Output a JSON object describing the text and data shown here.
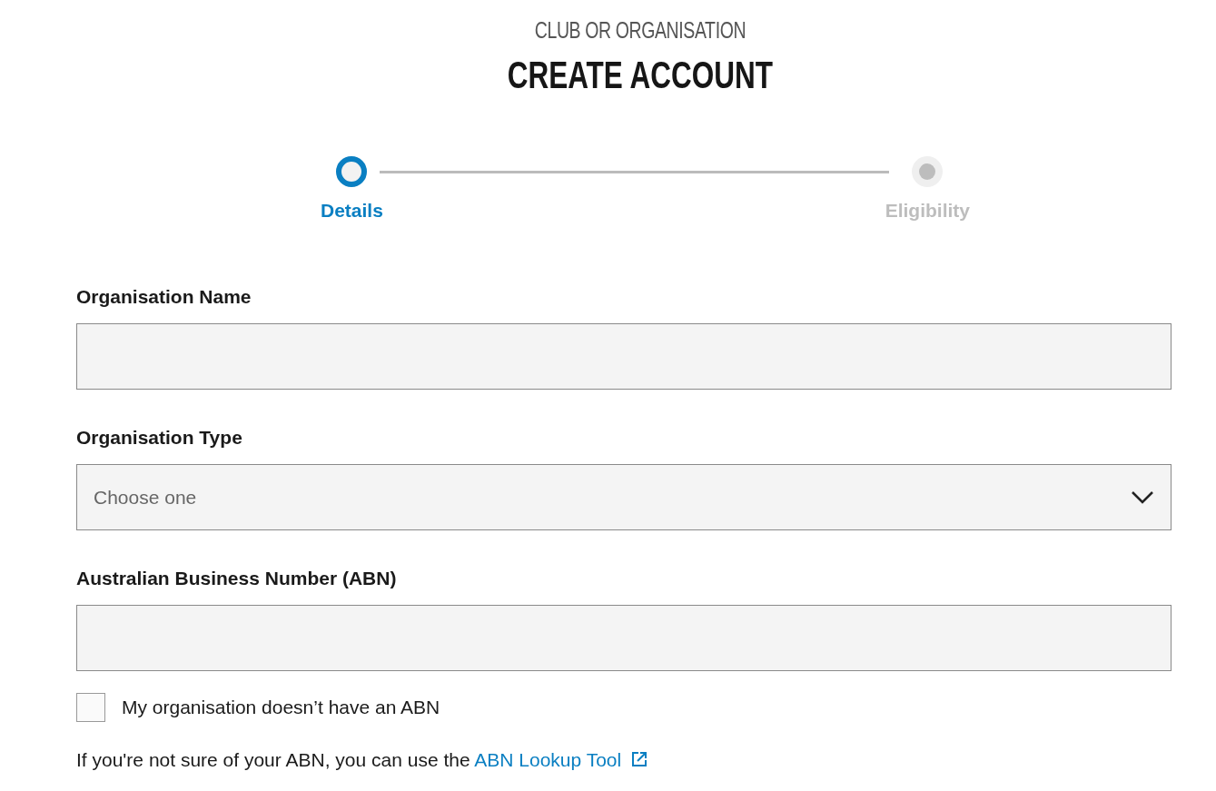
{
  "header": {
    "subtitle": "CLUB OR ORGANISATION",
    "title": "CREATE ACCOUNT"
  },
  "steps": [
    {
      "label": "Details",
      "selected": true
    },
    {
      "label": "Eligibility",
      "selected": false
    }
  ],
  "fields": [
    {
      "kind": "text",
      "label": "Organisation Name"
    },
    {
      "kind": "select",
      "label": "Organisation Type",
      "placeholder": "Choose one"
    },
    {
      "kind": "text",
      "label": "Australian Business Number (ABN)"
    }
  ],
  "checkbox": {
    "label": "My organisation doesn’t have an ABN",
    "checked": false
  },
  "help": {
    "text": "If you're not sure of your ABN, you can use the",
    "link": "ABN Lookup Tool"
  }
}
